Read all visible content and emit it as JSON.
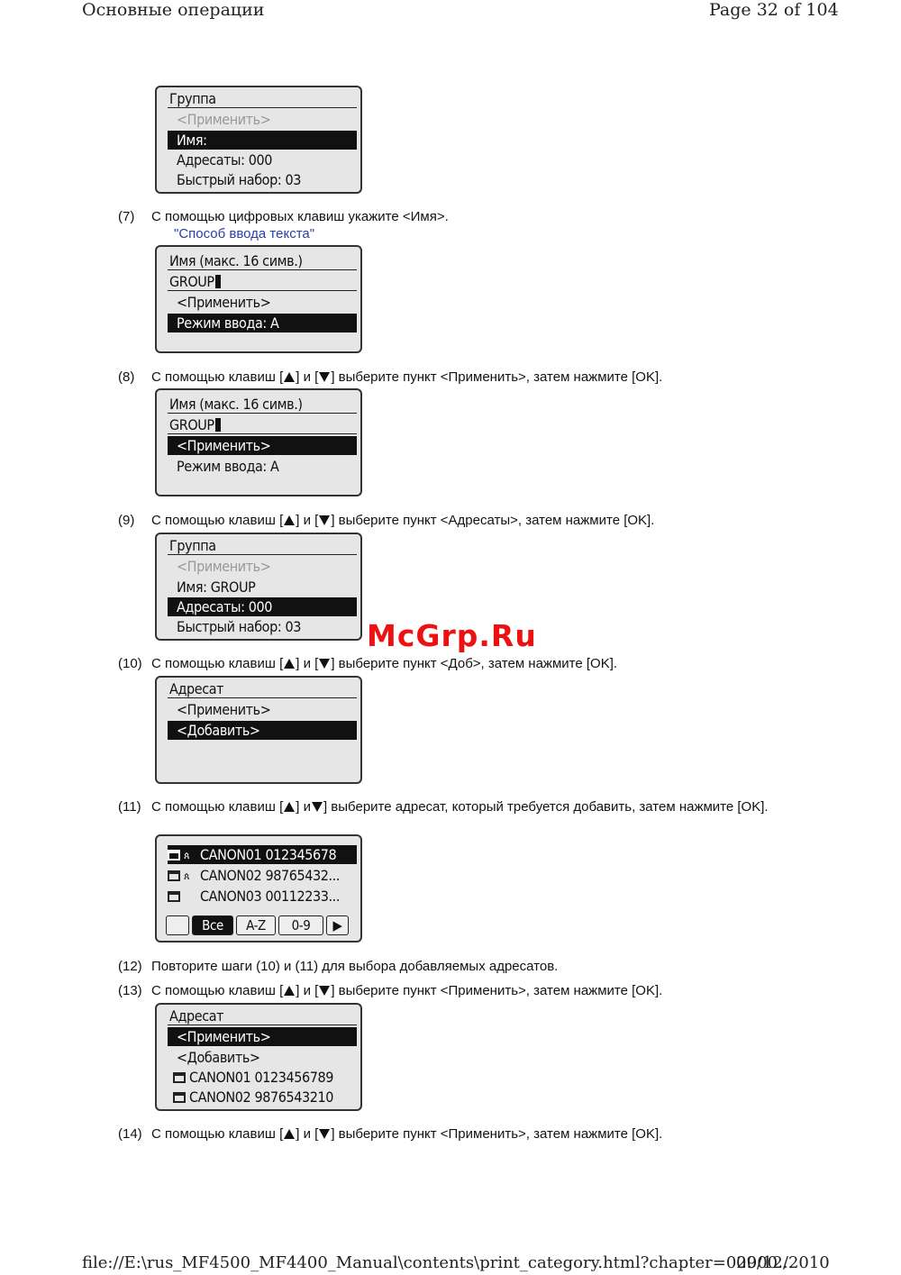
{
  "header": {
    "left": "Основные операции",
    "right": "Page 32 of 104"
  },
  "footer": {
    "path": "file://E:\\rus_MF4500_MF4400_Manual\\contents\\print_category.html?chapter=02000...",
    "date": "09/12/2010"
  },
  "watermark": "McGrp.Ru",
  "screen1": {
    "title": "Группа",
    "apply": "<Применить>",
    "name": "Имя:",
    "addressees": "Адресаты: 000",
    "speed": "Быстрый набор: 03"
  },
  "step7": {
    "num": "(7)",
    "text": "С помощью цифровых клавиш укажите <Имя>.",
    "link": "\"Способ ввода текста\""
  },
  "screen2": {
    "title": "Имя (макс. 16 симв.)",
    "input": "GROUP",
    "apply": "<Применить>",
    "mode": "Режим ввода: A"
  },
  "step8": {
    "num": "(8)",
    "pre": "С помощью клавиш [",
    "mid": "] и [",
    "post": "] выберите пункт <Применить>, затем нажмите [OK]."
  },
  "screen3": {
    "title": "Имя (макс. 16 симв.)",
    "input": "GROUP",
    "apply": "<Применить>",
    "mode": "Режим ввода: A"
  },
  "step9": {
    "num": "(9)",
    "pre": "С помощью клавиш [",
    "mid": "] и [",
    "post": "] выберите пункт <Адресаты>, затем нажмите [OK]."
  },
  "screen4": {
    "title": "Группа",
    "apply": "<Применить>",
    "name": "Имя: GROUP",
    "addressees": "Адресаты: 000",
    "speed": "Быстрый набор: 03"
  },
  "step10": {
    "num": "(10)",
    "pre": "С помощью клавиш [",
    "mid": "] и [",
    "post": "] выберите пункт <Доб>, затем нажмите [OK]."
  },
  "screen5": {
    "title": "Адресат",
    "apply": "<Применить>",
    "add": "<Добавить>"
  },
  "step11": {
    "num": "(11)",
    "pre": "С помощью клавиш [",
    "mid": "] и",
    "post": "] выберите адресат, который требуется добавить, затем нажмите [OK]."
  },
  "screen6": {
    "rows": [
      "CANON01  012345678",
      "CANON02  98765432...",
      "CANON03  00112233..."
    ],
    "tabs": {
      "all": "Все",
      "az": "A-Z",
      "digits": "0-9",
      "next": "▶"
    }
  },
  "step12": {
    "num": "(12)",
    "text": "Повторите шаги (10) и (11) для выбора добавляемых адресатов."
  },
  "step13": {
    "num": "(13)",
    "pre": "С помощью клавиш [",
    "mid": "] и [",
    "post": "] выберите пункт <Применить>, затем нажмите [OK]."
  },
  "screen7": {
    "title": "Адресат",
    "apply": "<Применить>",
    "add": "<Добавить>",
    "r1": "CANON01  0123456789",
    "r2": "CANON02  9876543210"
  },
  "step14": {
    "num": "(14)",
    "pre": "С помощью клавиш [",
    "mid": "] и [",
    "post": "] выберите пункт <Применить>, затем нажмите [OK]."
  }
}
